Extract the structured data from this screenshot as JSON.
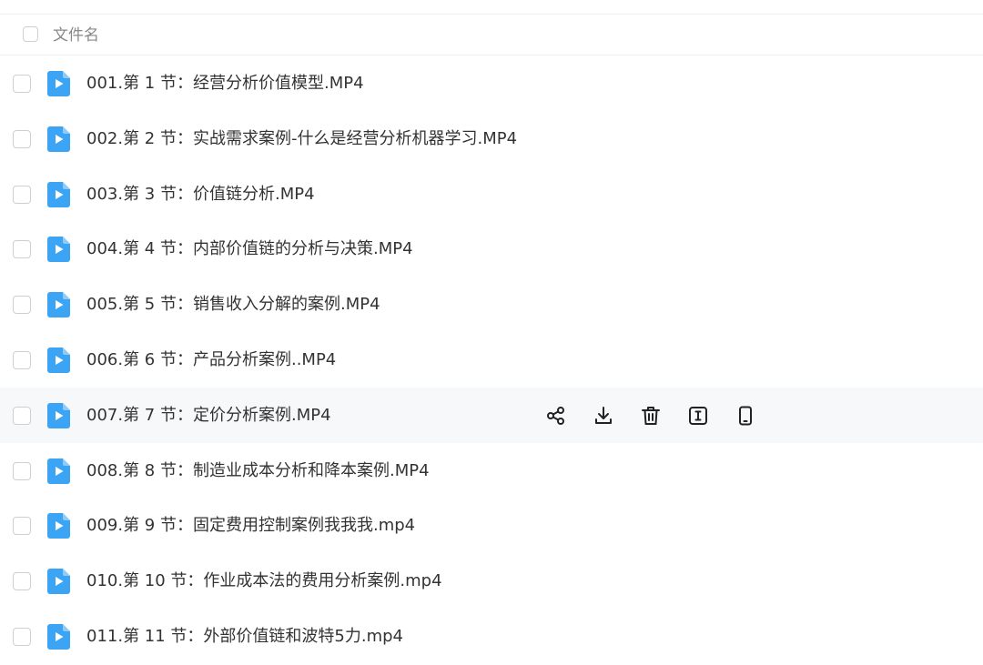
{
  "header": {
    "column_label": "文件名"
  },
  "files": [
    {
      "name": "001.第 1 节：经营分析价值模型.MP4"
    },
    {
      "name": "002.第 2 节：实战需求案例-什么是经营分析机器学习.MP4"
    },
    {
      "name": "003.第 3 节：价值链分析.MP4"
    },
    {
      "name": "004.第 4 节：内部价值链的分析与决策.MP4"
    },
    {
      "name": "005.第 5 节：销售收入分解的案例.MP4"
    },
    {
      "name": "006.第 6 节：产品分析案例..MP4"
    },
    {
      "name": "007.第 7 节：定价分析案例.MP4"
    },
    {
      "name": "008.第 8 节：制造业成本分析和降本案例.MP4"
    },
    {
      "name": "009.第 9 节：固定费用控制案例我我我.mp4"
    },
    {
      "name": "010.第 10 节：作业成本法的费用分析案例.mp4"
    },
    {
      "name": "011.第 11 节：外部价值链和波特5力.mp4"
    }
  ],
  "hovered_row_actions": [
    {
      "icon": "share-icon"
    },
    {
      "icon": "download-icon"
    },
    {
      "icon": "trash-icon"
    },
    {
      "icon": "rename-icon"
    },
    {
      "icon": "mobile-icon"
    }
  ],
  "colors": {
    "video_icon": "#3ba4f5",
    "hover_row_bg": "#f7f8fa",
    "action_icon": "#222222"
  }
}
